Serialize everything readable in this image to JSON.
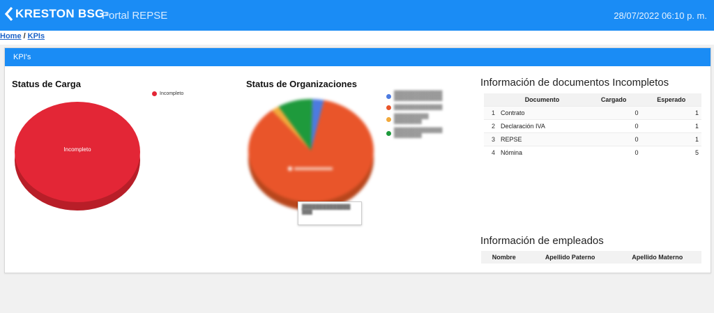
{
  "header": {
    "brand_name": "KRESTON BSG",
    "brand_mark": "®",
    "portal_title": "Portal REPSE",
    "datetime": "28/07/2022 06:10 p. m."
  },
  "breadcrumb": {
    "home": "Home",
    "separator": "/",
    "current": "KPIs"
  },
  "panel": {
    "title": "KPI's"
  },
  "status_carga": {
    "title": "Status de Carga",
    "legend": [
      {
        "label": "Incompleto",
        "color": "#e32636"
      }
    ],
    "slice_label": "Incompleto"
  },
  "status_organizaciones": {
    "title": "Status de Organizaciones",
    "legend_colors": [
      "#4d7be0",
      "#e9552a",
      "#f2a93b",
      "#1e9a3c"
    ]
  },
  "chart_data": [
    {
      "type": "pie",
      "title": "Status de Carga",
      "categories": [
        "Incompleto"
      ],
      "values": [
        100
      ],
      "colors": [
        "#e32636"
      ]
    },
    {
      "type": "pie",
      "title": "Status de Organizaciones",
      "categories": [],
      "values": [
        3,
        86,
        2,
        9
      ],
      "colors": [
        "#4d7be0",
        "#e9552a",
        "#f2a93b",
        "#1e9a3c"
      ]
    }
  ],
  "documentos": {
    "title": "Información de documentos Incompletos",
    "columns": [
      "Documento",
      "Cargado",
      "Esperado"
    ],
    "rows": [
      {
        "idx": "1",
        "documento": "Contrato",
        "cargado": "0",
        "esperado": "1"
      },
      {
        "idx": "2",
        "documento": "Declaración IVA",
        "cargado": "0",
        "esperado": "1"
      },
      {
        "idx": "3",
        "documento": "REPSE",
        "cargado": "0",
        "esperado": "1"
      },
      {
        "idx": "4",
        "documento": "Nómina",
        "cargado": "0",
        "esperado": "5"
      }
    ]
  },
  "empleados": {
    "title": "Información de empleados",
    "columns": [
      "Nombre",
      "Apellido Paterno",
      "Apellido Materno"
    ]
  }
}
